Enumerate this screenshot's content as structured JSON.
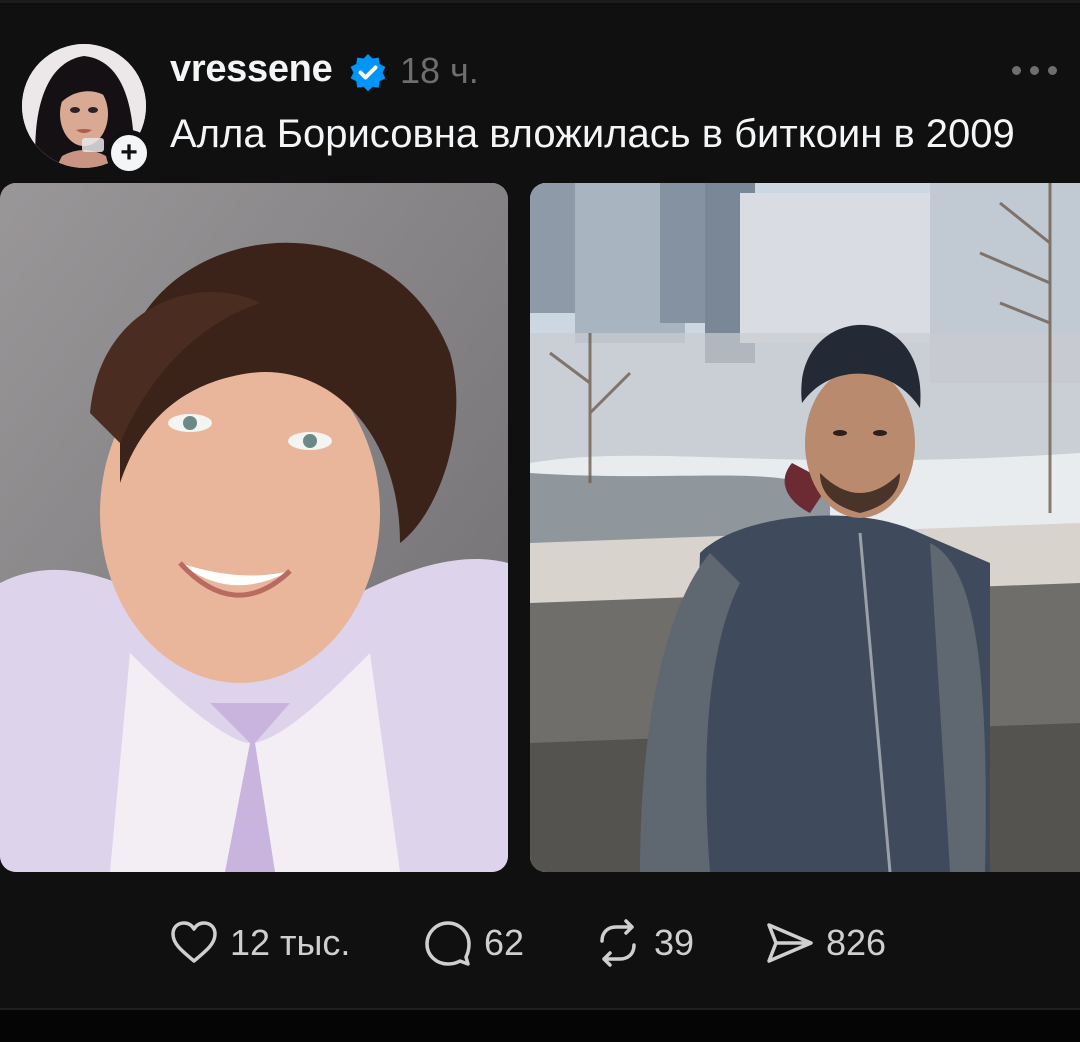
{
  "post": {
    "username": "vressene",
    "time": "18 ч.",
    "text": "Алла Борисовна вложилась в биткоин в 2009",
    "verified_color": "#0095f6"
  },
  "actions": {
    "likes": "12 тыс.",
    "comments": "62",
    "reposts": "39",
    "shares": "826"
  },
  "icons": {
    "more": "more-horizontal-icon",
    "follow": "plus-icon",
    "verified": "verified-badge-icon",
    "like": "heart-icon",
    "comment": "comment-bubble-icon",
    "repost": "repost-icon",
    "share": "send-icon"
  }
}
